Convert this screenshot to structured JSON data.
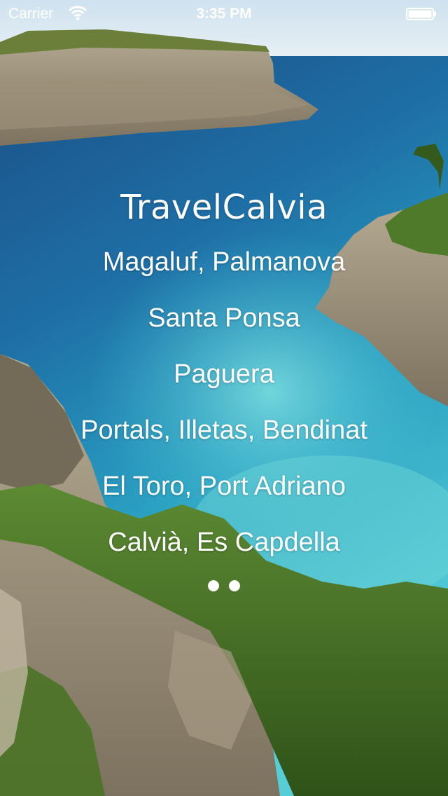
{
  "status_bar": {
    "carrier": "Carrier",
    "time": "3:35 PM",
    "wifi_icon": "wifi-icon",
    "battery_icon": "battery-icon"
  },
  "app": {
    "title": "TravelCalvia",
    "menu_items": [
      "Magaluf, Palmanova",
      "Santa Ponsa",
      "Paguera",
      "Portals, Illetas, Bendinat",
      "El Toro, Port Adriano",
      "Calvià, Es Capdella"
    ],
    "page_control": {
      "pages": 2
    }
  },
  "colors": {
    "text": "#ffffff",
    "sky": "#dde9f0",
    "sea_deep": "#1d5e95",
    "sea_light": "#4fc6d6",
    "vegetation": "#3f6a24",
    "rock": "#8c8270"
  }
}
